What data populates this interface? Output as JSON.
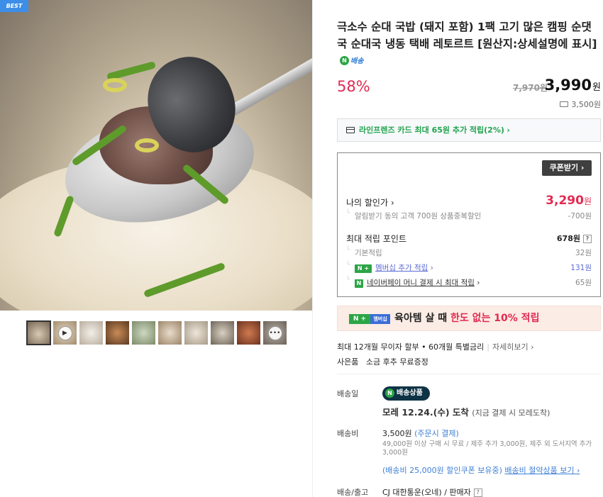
{
  "badge": "BEST",
  "thumbnails": [
    {
      "kind": "image"
    },
    {
      "kind": "video"
    },
    {
      "kind": "image"
    },
    {
      "kind": "image"
    },
    {
      "kind": "image"
    },
    {
      "kind": "image"
    },
    {
      "kind": "image"
    },
    {
      "kind": "image"
    },
    {
      "kind": "image"
    },
    {
      "kind": "more"
    }
  ],
  "product": {
    "title": "극소수 순대 국밥 (돼지 포함) 1팩 고기 많은 캠핑 순댓국 순대국 냉동 택배 레토르트 [원산지:상세설명에 표시]",
    "npay_label": "배송"
  },
  "pricing": {
    "discount_rate": "58%",
    "original_price": "7,970원",
    "sale_price": "3,990",
    "currency": "원",
    "shipping_fee": "3,500원"
  },
  "card_benefit": {
    "prefix": "라인프렌즈 카드 최대 65원 추가 적립(2%)",
    "arrow": "›"
  },
  "benefits": {
    "coupon_button": "쿠폰받기 ›",
    "my_price_label": "나의 할인가 ›",
    "my_price_value": "3,290",
    "my_price_unit": "원",
    "alert_discount_label": "알림받기 동의 고객 700원 상품중복할인",
    "alert_discount_value": "-700원",
    "max_points_label": "최대 적립 포인트",
    "max_points_value": "678원",
    "base_points_label": "기본적립",
    "base_points_value": "32원",
    "membership_label": "멤버십 추가 적립",
    "membership_value": "131원",
    "npay_money_label": "네이버페이 머니 결제 시 최대 적립",
    "npay_money_value": "65원",
    "arrow": "›",
    "help": "?"
  },
  "promo": {
    "n_plus": "N +",
    "membership": "멤버십",
    "text": "육아템 살 때",
    "highlight": "한도 없는 10% 적립"
  },
  "installment": {
    "text": "최대 12개월 무이자 할부 • 60개월 특별금리",
    "link": "자세히보기 ›"
  },
  "gift": {
    "label": "사은품",
    "value": "소금 후추 무료증정"
  },
  "delivery": {
    "date_label": "배송일",
    "badge": "배송상품",
    "arrival": "모레 12.24.(수) 도착",
    "arrival_note": "(지금 결제 시 모레도착)",
    "fee_label": "배송비",
    "fee_value": "3,500원",
    "fee_note": "(주문시 결제)",
    "fee_detail": "49,000원 이상 구매 시 무료 / 제주 추가 3,000원, 제주 외 도서지역 추가 3,000원",
    "coupon_note": "(배송비 25,000원 할인쿠폰 보유중)",
    "saving_link": "배송비 절약상품 보기 ›",
    "courier_label": "배송/출고",
    "courier_value": "CJ 대한통운(오네) / 판매자"
  },
  "colors": {
    "discount_red": "#e22a52",
    "naver_green": "#2ca546",
    "link_blue": "#3e7fd6"
  }
}
